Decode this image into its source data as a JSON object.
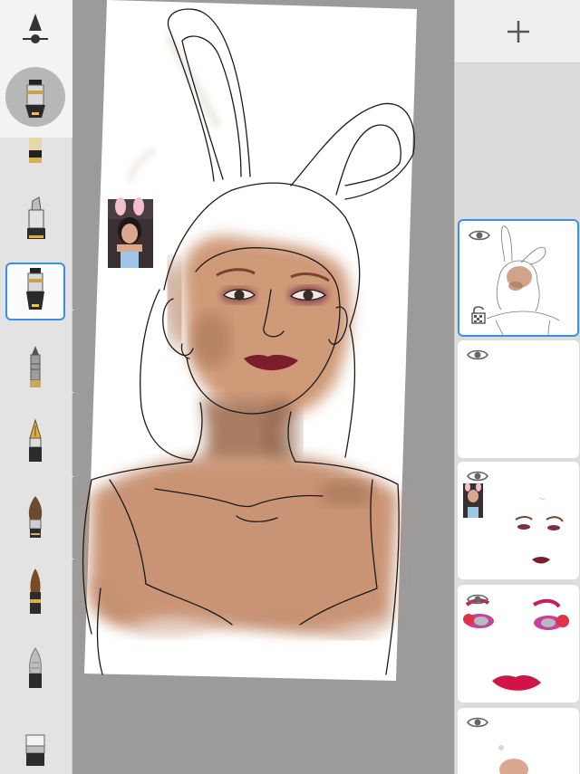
{
  "app": {
    "accent_color": "#3b8fe6"
  },
  "brush_toolbar": {
    "size_tool_icon": "brush-size-slider-icon",
    "current_brush_icon": "airbrush-icon",
    "brushes": [
      {
        "name": "pencil",
        "icon": "pencil-icon"
      },
      {
        "name": "marker",
        "icon": "marker-icon"
      },
      {
        "name": "airbrush",
        "icon": "airbrush-icon",
        "selected": true
      },
      {
        "name": "ballpoint",
        "icon": "ballpoint-pen-icon"
      },
      {
        "name": "fountain-pen",
        "icon": "fountain-pen-icon"
      },
      {
        "name": "paint-brush",
        "icon": "paint-brush-icon"
      },
      {
        "name": "ink-brush",
        "icon": "ink-brush-icon"
      },
      {
        "name": "smudge",
        "icon": "smudge-tool-icon"
      },
      {
        "name": "eraser",
        "icon": "eraser-icon"
      }
    ]
  },
  "layers_panel": {
    "add_icon": "plus-icon",
    "layers": [
      {
        "name": "sketch-layer",
        "visible": true,
        "active": true,
        "locked": true
      },
      {
        "name": "empty-layer",
        "visible": true
      },
      {
        "name": "face-details-layer",
        "visible": true,
        "has_reference_photo": true
      },
      {
        "name": "makeup-layer",
        "visible": true
      },
      {
        "name": "skin-layer",
        "visible": true
      }
    ]
  }
}
